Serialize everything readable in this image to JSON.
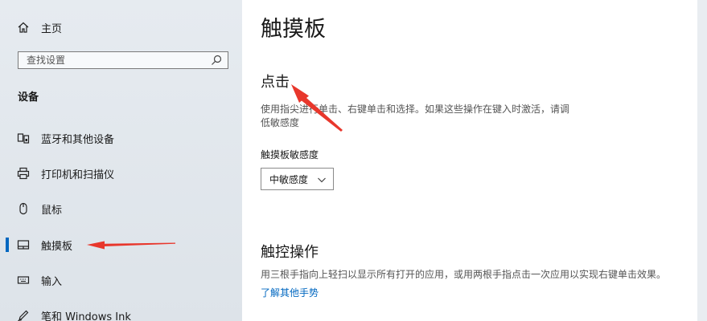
{
  "sidebar": {
    "home_label": "主页",
    "search_placeholder": "查找设置",
    "section_title": "设备",
    "items": [
      {
        "label": "蓝牙和其他设备",
        "icon": "bluetooth-devices-icon"
      },
      {
        "label": "打印机和扫描仪",
        "icon": "printer-icon"
      },
      {
        "label": "鼠标",
        "icon": "mouse-icon"
      },
      {
        "label": "触摸板",
        "icon": "touchpad-icon",
        "selected": true
      },
      {
        "label": "输入",
        "icon": "keyboard-icon"
      },
      {
        "label": "笔和 Windows Ink",
        "icon": "pen-icon"
      }
    ],
    "accent_color": "#0067c0"
  },
  "main": {
    "page_title": "触摸板",
    "tap_section": {
      "title": "点击",
      "description_line1": "使用指尖进行单击、右键单击和选择。如果这些操作在键入时激活，请调",
      "description_line2": "低敏感度",
      "sensitivity_label": "触摸板敏感度",
      "sensitivity_value": "中敏感度"
    },
    "gesture_section": {
      "title": "触控操作",
      "description": "用三根手指向上轻扫以显示所有打开的应用，或用两根手指点击一次应用以实现右键单击效果。",
      "link_text": "了解其他手势"
    }
  },
  "annotation_color": "#e8372c"
}
